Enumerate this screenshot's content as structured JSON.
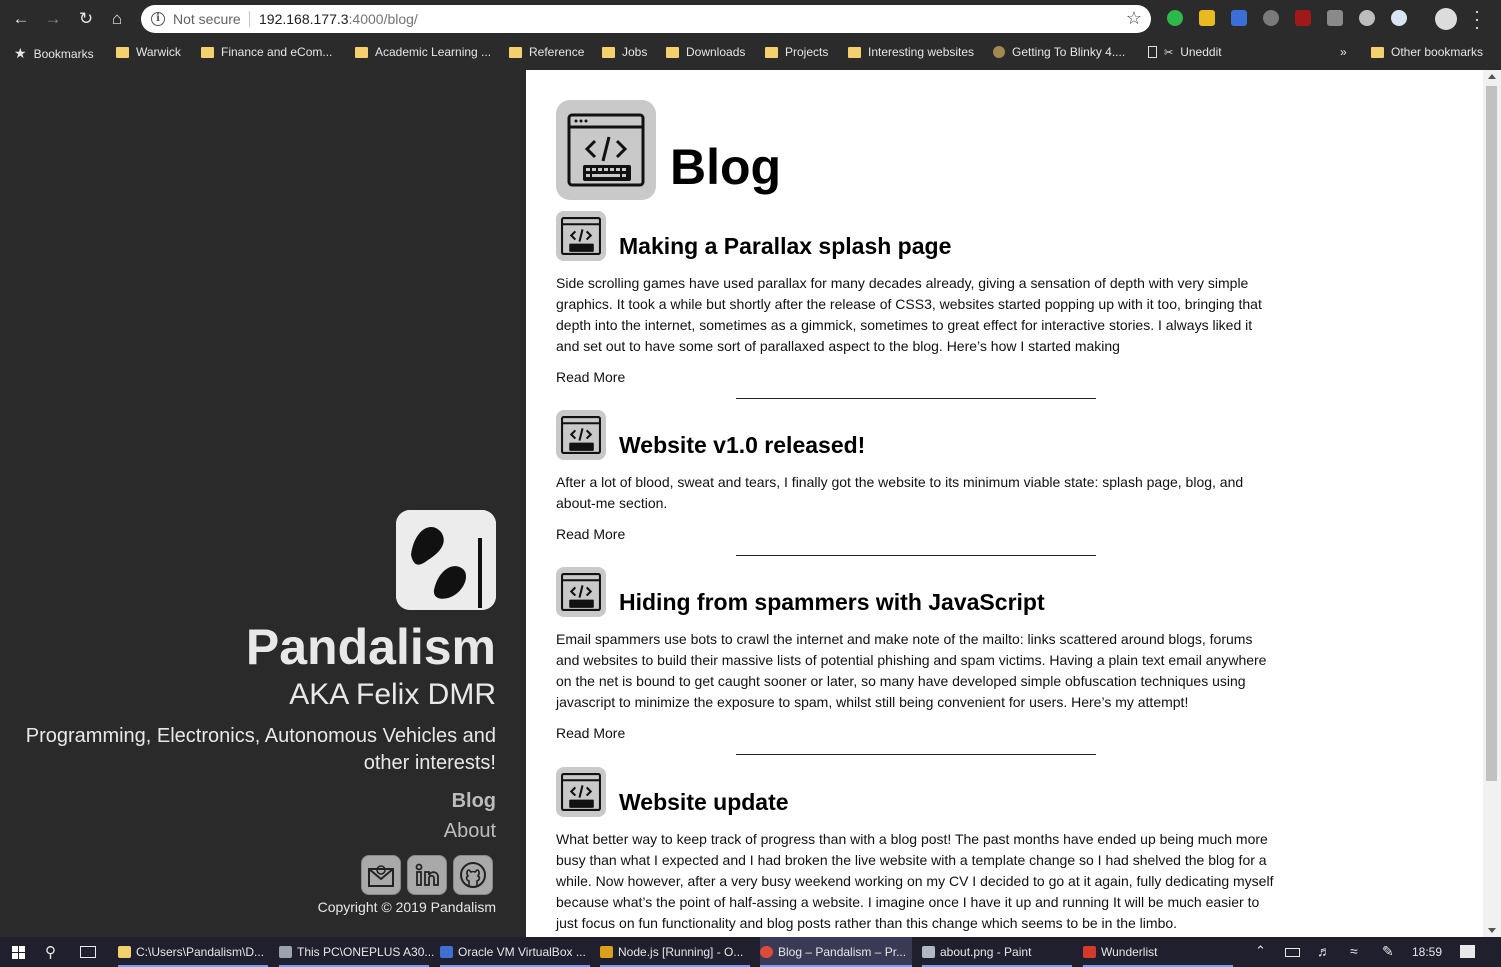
{
  "browser": {
    "security_label": "Not secure",
    "url_host": "192.168.177.3",
    "url_rest": ":4000/blog/",
    "bookmarks": [
      {
        "label": "Bookmarks"
      },
      {
        "label": "Warwick"
      },
      {
        "label": "Finance and eCom..."
      },
      {
        "label": "Academic Learning ..."
      },
      {
        "label": "Reference"
      },
      {
        "label": "Jobs"
      },
      {
        "label": "Downloads"
      },
      {
        "label": "Projects"
      },
      {
        "label": "Interesting websites"
      },
      {
        "label": "Getting To Blinky 4...."
      },
      {
        "label": "Uneddit"
      }
    ],
    "overflow_label": "»",
    "other_bookmarks": "Other bookmarks",
    "colors": {
      "chrome_bg": "#2b2b2b",
      "folder": "#f4d06f"
    }
  },
  "sidebar": {
    "site_name": "Pandalism",
    "aka": "AKA Felix DMR",
    "tagline": "Programming, Electronics, Autonomous Vehicles and other interests!",
    "nav": [
      {
        "label": "Blog"
      },
      {
        "label": "About"
      }
    ],
    "socials": [
      {
        "icon": "email-icon"
      },
      {
        "icon": "linkedin-icon"
      },
      {
        "icon": "github-icon"
      }
    ],
    "copyright": "Copyright © 2019 Pandalism",
    "colors": {
      "bg": "#2a2a2a",
      "text": "#e8e8e8"
    }
  },
  "main": {
    "page_title": "Blog",
    "read_more_label": "Read More",
    "posts": [
      {
        "title": "Making a Parallax splash page",
        "excerpt": "Side scrolling games have used parallax for many decades already, giving a sensation of depth with very simple graphics. It took a while but shortly after the release of CSS3, websites started popping up with it too, bringing that depth into the internet, sometimes as a gimmick, sometimes to great effect for interactive stories. I always liked it and set out to have some sort of parallaxed aspect to the blog. Here’s how I started making"
      },
      {
        "title": "Website v1.0 released!",
        "excerpt": "After a lot of blood, sweat and tears, I finally got the website to its minimum viable state: splash page, blog, and about-me section."
      },
      {
        "title": "Hiding from spammers with JavaScript",
        "excerpt": "Email spammers use bots to crawl the internet and make note of the mailto: links scattered around blogs, forums and websites to build their massive lists of potential phishing and spam victims. Having a plain text email anywhere on the net is bound to get caught sooner or later, so many have developed simple obfuscation techniques using javascript to minimize the exposure to spam, whilst still being convenient for users. Here’s my attempt!"
      },
      {
        "title": "Website update",
        "excerpt": "What better way to keep track of progress than with a blog post! The past months have ended up being much more busy than what I expected and I had broken the live website with a template change so I had shelved the blog for a while. Now however, after a very busy weekend working on my CV I decided to go at it again, fully dedicating myself because what’s the point of half-assing a website. I imagine once I have it up and running It will be much easier to just focus on fun functionality and blog posts rather than this change which seems to be in the limbo."
      }
    ]
  },
  "taskbar": {
    "items": [
      {
        "label": "C:\\Users\\Pandalism\\D...",
        "active": false
      },
      {
        "label": "This PC\\ONEPLUS A30...",
        "active": false
      },
      {
        "label": "Oracle VM VirtualBox ...",
        "active": false
      },
      {
        "label": "Node.js [Running] - O...",
        "active": false
      },
      {
        "label": "Blog – Pandalism – Pr...",
        "active": true
      },
      {
        "label": "about.png - Paint",
        "active": false
      },
      {
        "label": "Wunderlist",
        "active": false
      }
    ],
    "clock": "18:59"
  }
}
